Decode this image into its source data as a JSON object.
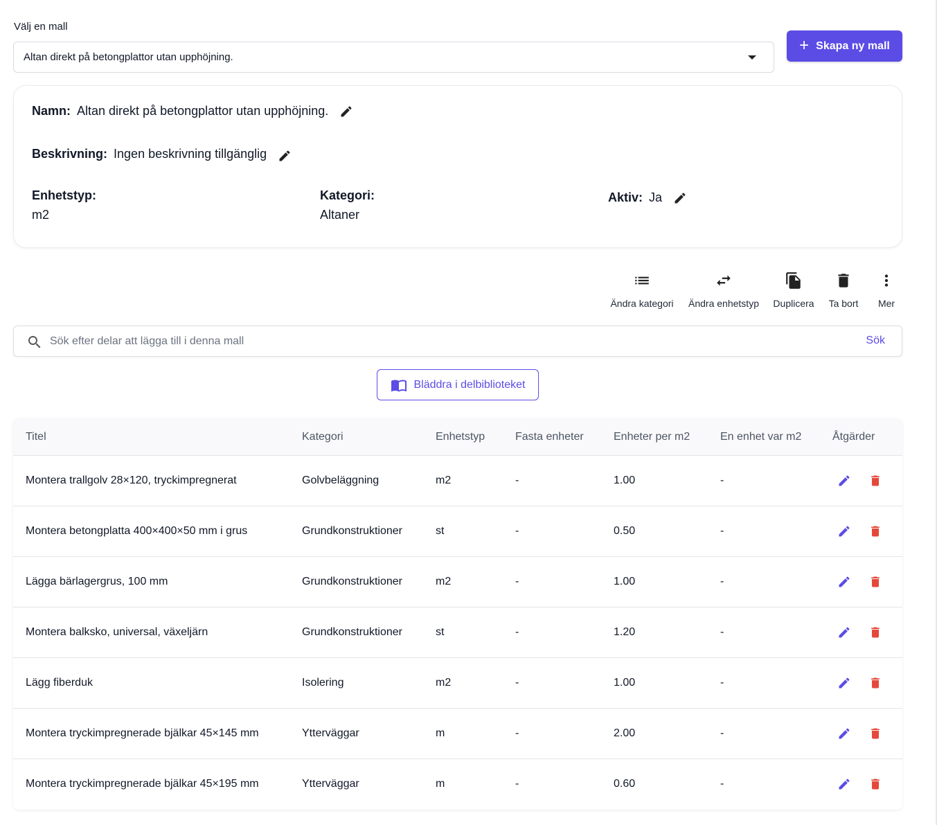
{
  "template_select": {
    "label": "Välj en mall",
    "value": "Altan direkt på betongplattor utan upphöjning."
  },
  "create_button": {
    "label": "Skapa ny mall"
  },
  "details": {
    "name_label": "Namn:",
    "name_value": "Altan direkt på betongplattor utan upphöjning.",
    "description_label": "Beskrivning:",
    "description_value": "Ingen beskrivning tillgänglig",
    "unit_type_label": "Enhetstyp:",
    "unit_type_value": "m2",
    "category_label": "Kategori:",
    "category_value": "Altaner",
    "active_label": "Aktiv:",
    "active_value": "Ja"
  },
  "toolbar": {
    "change_category": "Ändra kategori",
    "change_unit_type": "Ändra enhetstyp",
    "duplicate": "Duplicera",
    "delete": "Ta bort",
    "more": "Mer"
  },
  "search": {
    "placeholder": "Sök efter delar att lägga till i denna mall",
    "button": "Sök"
  },
  "browse_button": {
    "label": "Bläddra i delbiblioteket"
  },
  "table": {
    "headers": {
      "title": "Titel",
      "category": "Kategori",
      "unit_type": "Enhetstyp",
      "fixed_units": "Fasta enheter",
      "units_per": "Enheter per m2",
      "one_unit_per": "En enhet var m2",
      "actions": "Åtgärder"
    },
    "rows": [
      {
        "title": "Montera trallgolv 28×120, tryckimpregnerat",
        "category": "Golvbeläggning",
        "unit_type": "m2",
        "fixed_units": "-",
        "units_per": "1.00",
        "one_unit_per": "-"
      },
      {
        "title": "Montera betongplatta 400×400×50 mm i grus",
        "category": "Grundkonstruktioner",
        "unit_type": "st",
        "fixed_units": "-",
        "units_per": "0.50",
        "one_unit_per": "-"
      },
      {
        "title": "Lägga bärlagergrus, 100 mm",
        "category": "Grundkonstruktioner",
        "unit_type": "m2",
        "fixed_units": "-",
        "units_per": "1.00",
        "one_unit_per": "-"
      },
      {
        "title": "Montera balksko, universal, växeljärn",
        "category": "Grundkonstruktioner",
        "unit_type": "st",
        "fixed_units": "-",
        "units_per": "1.20",
        "one_unit_per": "-"
      },
      {
        "title": "Lägg fiberduk",
        "category": "Isolering",
        "unit_type": "m2",
        "fixed_units": "-",
        "units_per": "1.00",
        "one_unit_per": "-"
      },
      {
        "title": "Montera tryckimpregnerade bjälkar 45×145 mm",
        "category": "Ytterväggar",
        "unit_type": "m",
        "fixed_units": "-",
        "units_per": "2.00",
        "one_unit_per": "-"
      },
      {
        "title": "Montera tryckimpregnerade bjälkar 45×195 mm",
        "category": "Ytterväggar",
        "unit_type": "m",
        "fixed_units": "-",
        "units_per": "0.60",
        "one_unit_per": "-"
      }
    ]
  },
  "colors": {
    "primary": "#5b4ce6",
    "danger": "#e5483b",
    "text": "#111827"
  }
}
